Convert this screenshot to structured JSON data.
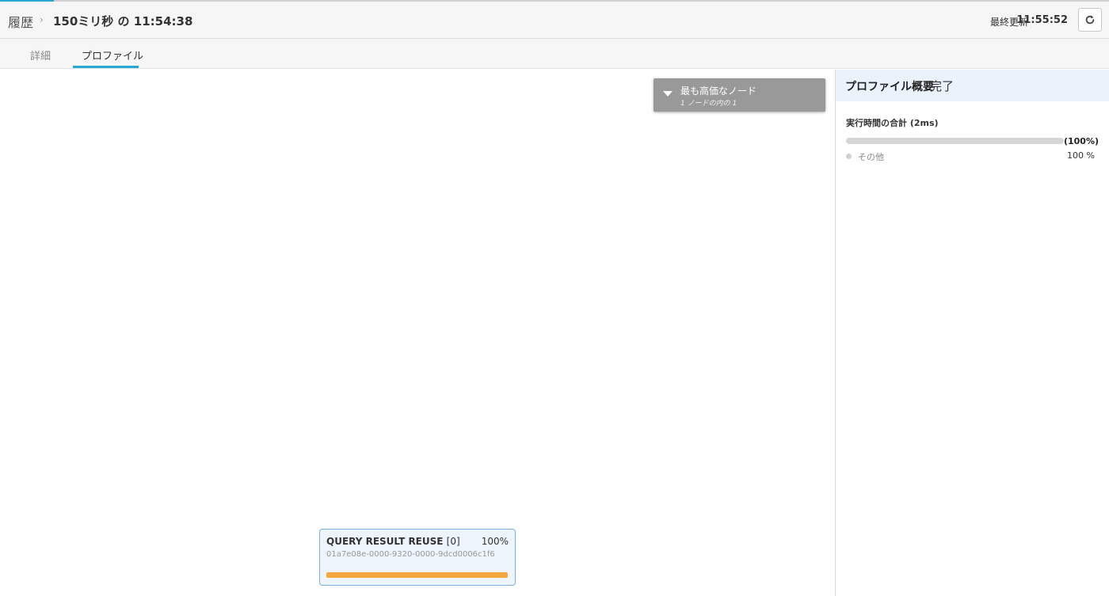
{
  "header": {
    "breadcrumb_root": "履歴",
    "breadcrumb_separator": "›",
    "title": "150ミリ秒 の 11:54:38",
    "last_updated_label": "最終更新",
    "last_updated_time": "11:55:52",
    "refresh_icon": "refresh-icon"
  },
  "tabs": [
    {
      "label": "詳細",
      "active": false
    },
    {
      "label": "プロファイル",
      "active": true
    }
  ],
  "canvas": {
    "most_expensive": {
      "title": "最も高価なノード",
      "subtitle": "1 ノードの内の 1"
    },
    "node": {
      "title": "QUERY RESULT REUSE",
      "index": "[0]",
      "percent": "100%",
      "id": "01a7e08e-0000-9320-0000-9dcd0006c1f6",
      "progress_fraction": 1.0,
      "bar_color": "#f4a73e"
    }
  },
  "panel": {
    "title": "プロファイル概要",
    "status": "完了",
    "exec_label": "実行時間の合計 (2ms)",
    "exec_percent": "(100%)",
    "breakdown": [
      {
        "label": "その他",
        "percent": "100 %"
      }
    ]
  },
  "colors": {
    "accent": "#29a8d8",
    "node_border": "#7aaedd",
    "panel_header": "#eaf3fc"
  }
}
